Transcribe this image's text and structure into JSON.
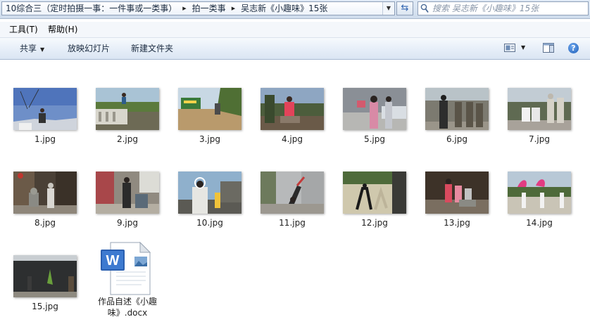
{
  "address_bar": {
    "breadcrumbs": [
      "10综合三（定时拍摄一事：一件事或一类事）",
      "拍一类事",
      "吴志新《小趣味》15张"
    ]
  },
  "search": {
    "placeholder": "搜索 吴志新《小趣味》15张",
    "icon": "magnifier-icon"
  },
  "menu": {
    "items": [
      "工具(T)",
      "帮助(H)"
    ]
  },
  "toolbar": {
    "share_label": "共享",
    "slideshow_label": "放映幻灯片",
    "new_folder_label": "新建文件夹"
  },
  "files": [
    {
      "name": "1.jpg"
    },
    {
      "name": "2.jpg"
    },
    {
      "name": "3.jpg"
    },
    {
      "name": "4.jpg"
    },
    {
      "name": "5.jpg"
    },
    {
      "name": "6.jpg"
    },
    {
      "name": "7.jpg"
    },
    {
      "name": "8.jpg"
    },
    {
      "name": "9.jpg"
    },
    {
      "name": "10.jpg"
    },
    {
      "name": "11.jpg"
    },
    {
      "name": "12.jpg"
    },
    {
      "name": "13.jpg"
    },
    {
      "name": "14.jpg"
    },
    {
      "name": "15.jpg"
    },
    {
      "name": "作品自述《小趣味》.docx",
      "line1": "作品自述《小趣",
      "line2": "味》.docx",
      "icon": "word-document-icon"
    }
  ]
}
